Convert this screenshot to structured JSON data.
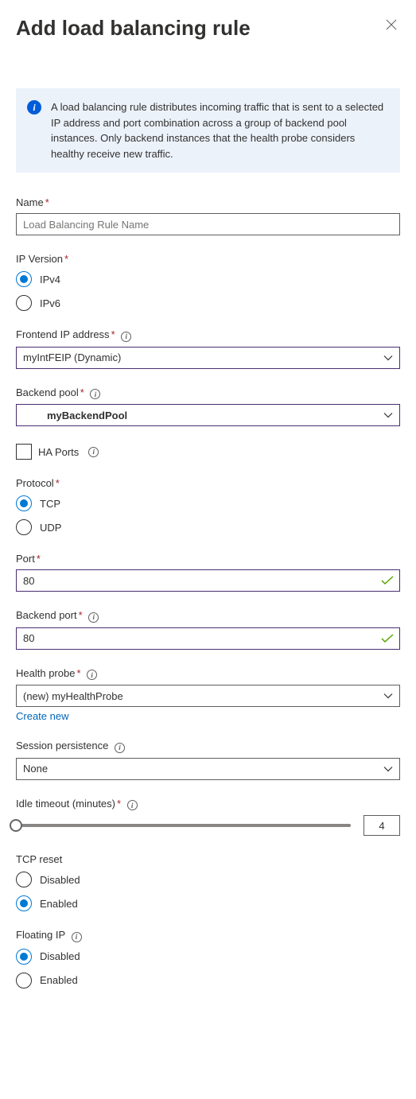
{
  "header": {
    "title": "Add load balancing rule"
  },
  "info": {
    "text": "A load balancing rule distributes incoming traffic that is sent to a selected IP address and port combination across a group of backend pool instances. Only backend instances that the health probe considers healthy receive new traffic."
  },
  "fields": {
    "name": {
      "label": "Name",
      "placeholder": "Load Balancing Rule Name",
      "value": ""
    },
    "ipVersion": {
      "label": "IP Version",
      "options": [
        "IPv4",
        "IPv6"
      ],
      "selected": "IPv4"
    },
    "frontendIp": {
      "label": "Frontend IP address",
      "value": "myIntFEIP (Dynamic)"
    },
    "backendPool": {
      "label": "Backend pool",
      "value": "myBackendPool"
    },
    "haPorts": {
      "label": "HA Ports",
      "checked": false
    },
    "protocol": {
      "label": "Protocol",
      "options": [
        "TCP",
        "UDP"
      ],
      "selected": "TCP"
    },
    "port": {
      "label": "Port",
      "value": "80"
    },
    "backendPort": {
      "label": "Backend port",
      "value": "80"
    },
    "healthProbe": {
      "label": "Health probe",
      "value": "(new) myHealthProbe",
      "createNew": "Create new"
    },
    "sessionPersistence": {
      "label": "Session persistence",
      "value": "None"
    },
    "idleTimeout": {
      "label": "Idle timeout (minutes)",
      "value": "4"
    },
    "tcpReset": {
      "label": "TCP reset",
      "options": [
        "Disabled",
        "Enabled"
      ],
      "selected": "Enabled"
    },
    "floatingIp": {
      "label": "Floating IP",
      "options": [
        "Disabled",
        "Enabled"
      ],
      "selected": "Disabled"
    }
  }
}
